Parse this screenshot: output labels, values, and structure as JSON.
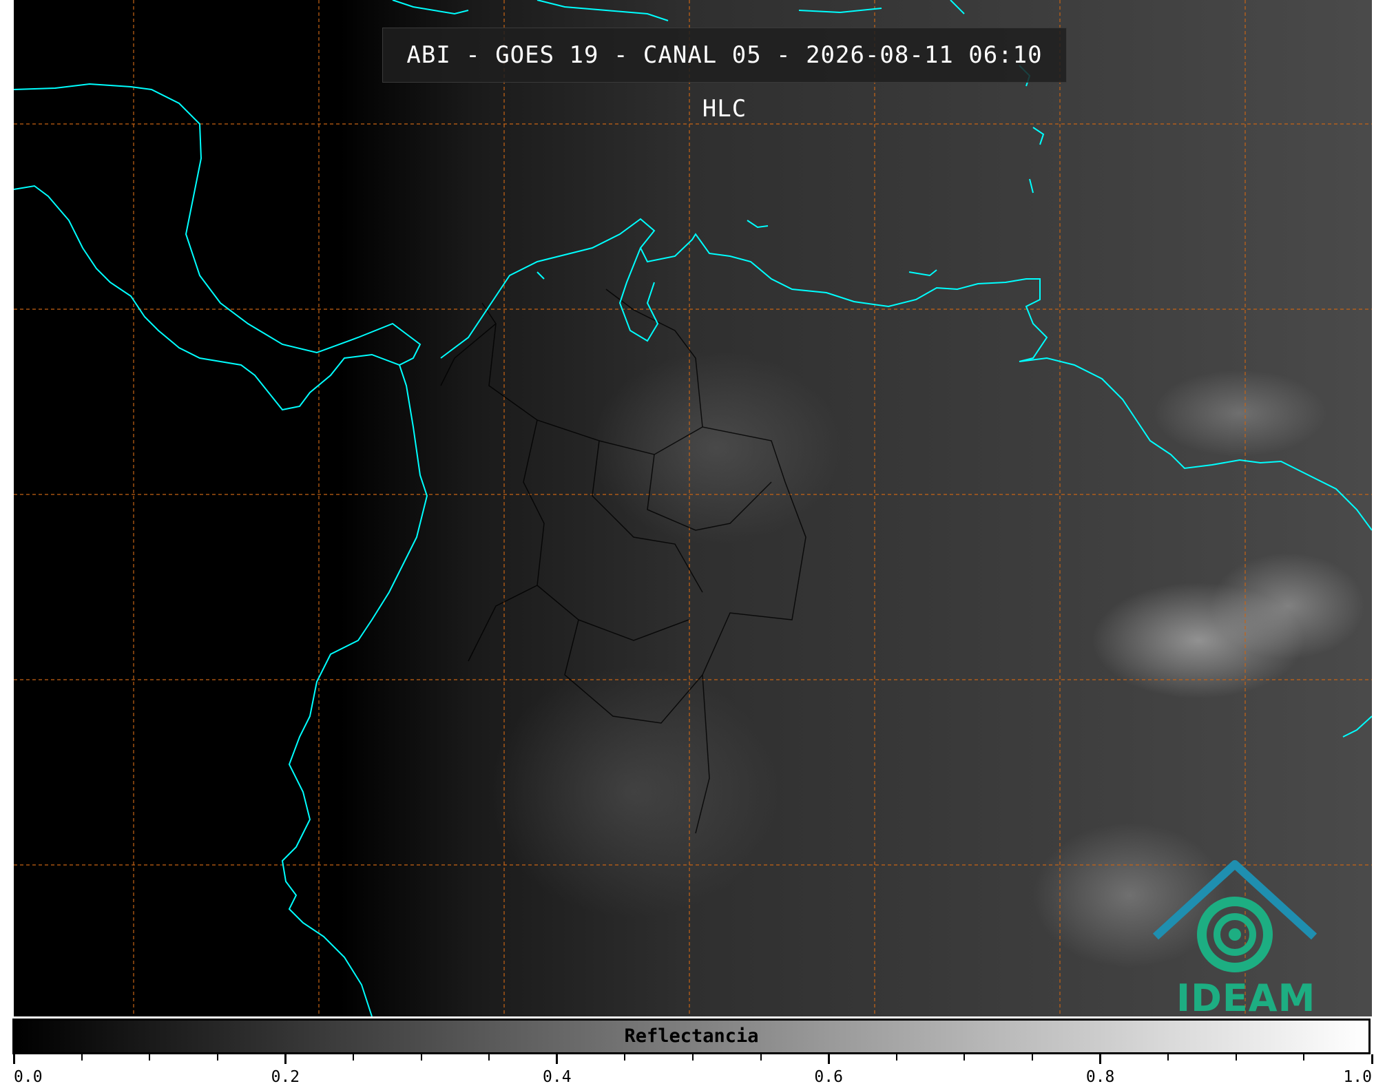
{
  "title": "ABI - GOES 19 - CANAL 05 - 2026-08-11 06:10 HLC",
  "logo_text": "IDEAM",
  "colors": {
    "coastline": "#00ffff",
    "gridlines": "#c86414",
    "borders": "#000000",
    "logo_primary": "#1dae82",
    "logo_accent": "#2a6fcf"
  },
  "colorbar": {
    "label": "Reflectancia",
    "min": 0.0,
    "max": 1.0,
    "tick_labels": [
      "0.0",
      "0.2",
      "0.4",
      "0.6",
      "0.8",
      "1.0"
    ],
    "colormap": "grayscale"
  },
  "map": {
    "type": "satellite-imagery",
    "gridlines": "dashed"
  }
}
